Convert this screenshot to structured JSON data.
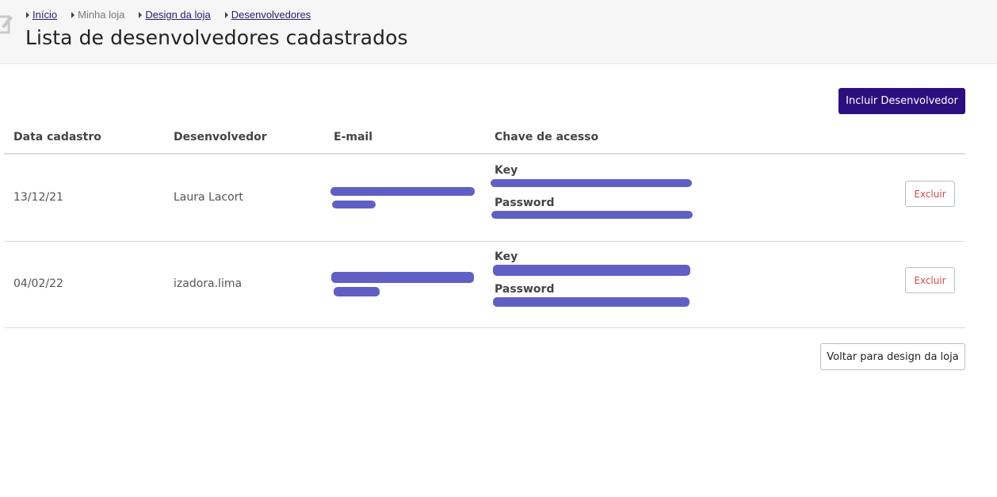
{
  "breadcrumb": [
    {
      "label": "Início",
      "link": true
    },
    {
      "label": "Minha loja",
      "link": false
    },
    {
      "label": "Design da loja",
      "link": true
    },
    {
      "label": "Desenvolvedores",
      "link": true
    }
  ],
  "header": {
    "title": "Lista de desenvolvedores cadastrados",
    "icon": "edit-icon"
  },
  "actions": {
    "add_label": "Incluir Desenvolvedor",
    "back_label": "Voltar para design da loja"
  },
  "table": {
    "columns": [
      "Data cadastro",
      "Desenvolvedor",
      "E-mail",
      "Chave de acesso"
    ],
    "key_label": "Key",
    "password_label": "Password",
    "delete_label": "Excluir",
    "rows": [
      {
        "date": "13/12/21",
        "developer": "Laura Lacort"
      },
      {
        "date": "04/02/22",
        "developer": "izadora.lima"
      }
    ]
  },
  "colors": {
    "primary": "#2c0f7e",
    "redaction": "#6060c4",
    "delete_text": "#d64a4a",
    "link": "#2a1a6e"
  }
}
